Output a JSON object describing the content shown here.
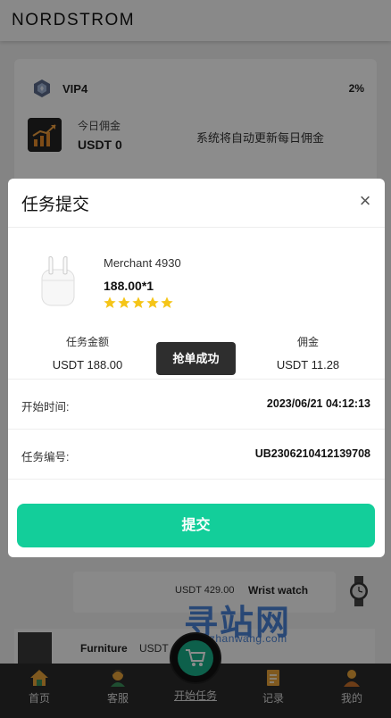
{
  "header": {
    "brand": "NORDSTROM"
  },
  "vip_card": {
    "level": "VIP4",
    "percent": "2%",
    "today_label": "今日佣金",
    "today_value": "USDT 0",
    "auto_update_text": "系统将自动更新每日佣金"
  },
  "background_products": [
    {
      "price": "USDT 429.00",
      "name": "Wrist watch",
      "icon": "wrist-watch-icon"
    },
    {
      "name": "Furniture",
      "price": "USDT"
    }
  ],
  "watermark": {
    "text": "寻站网",
    "subtext": "xunzhanwang.com"
  },
  "tabbar": {
    "items": [
      {
        "label": "首页",
        "icon": "home-icon"
      },
      {
        "label": "客服",
        "icon": "support-agent-icon"
      },
      {
        "label": "开始任务",
        "icon": "shopping-cart-icon"
      },
      {
        "label": "记录",
        "icon": "record-icon"
      },
      {
        "label": "我的",
        "icon": "user-icon"
      }
    ]
  },
  "modal": {
    "title": "任务提交",
    "close_icon": "close-icon",
    "product": {
      "image": "earbuds-icon",
      "merchant": "Merchant 4930",
      "price_qty": "188.00*1",
      "rating": 5
    },
    "task_amount": {
      "label": "任务金额",
      "value": "USDT  188.00"
    },
    "commission": {
      "label": "佣金",
      "value": "USDT  11.28"
    },
    "toast": "抢单成功",
    "start_time": {
      "label": "开始时间:",
      "value": "2023/06/21 04:12:13"
    },
    "task_no": {
      "label": "任务编号:",
      "value": "UB2306210412139708"
    },
    "submit_label": "提交"
  },
  "colors": {
    "accent": "#13ce9a",
    "star": "#f5c518",
    "tabbar_bg": "#2b2b2b",
    "toast_bg": "#2e2e2e"
  }
}
